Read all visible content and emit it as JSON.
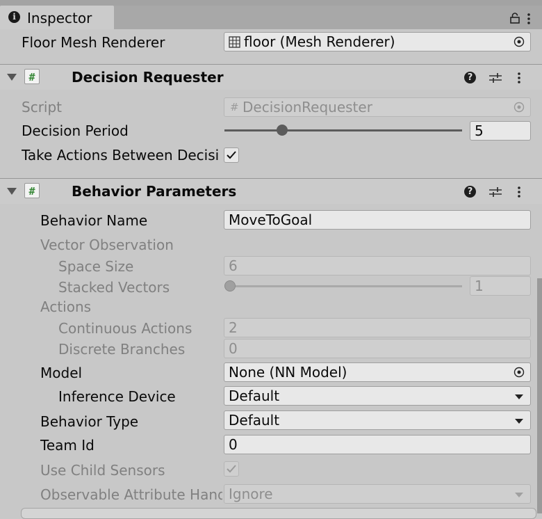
{
  "window": {
    "tab_title": "Inspector",
    "info_icon": "info-icon",
    "lock_icon": "lock-icon",
    "menu_icon": "kebab-menu-icon"
  },
  "floor_mesh": {
    "label": "Floor Mesh Renderer",
    "value": "floor (Mesh Renderer)",
    "icon": "mesh-renderer-icon"
  },
  "decision_requester": {
    "title": "Decision Requester",
    "script_label": "Script",
    "script_value": "DecisionRequester",
    "period_label": "Decision Period",
    "period_value": "5",
    "period_slider_fraction": 0.22,
    "take_actions_label": "Take Actions Between Decisi",
    "take_actions_checked": true
  },
  "behavior_parameters": {
    "title": "Behavior Parameters",
    "behavior_name_label": "Behavior Name",
    "behavior_name_value": "MoveToGoal",
    "vector_obs_label": "Vector Observation",
    "space_size_label": "Space Size",
    "space_size_value": "6",
    "stacked_vectors_label": "Stacked Vectors",
    "stacked_vectors_value": "1",
    "stacked_slider_fraction": 0.0,
    "actions_label": "Actions",
    "continuous_label": "Continuous Actions",
    "continuous_value": "2",
    "discrete_label": "Discrete Branches",
    "discrete_value": "0",
    "model_label": "Model",
    "model_value": "None (NN Model)",
    "inference_label": "Inference Device",
    "inference_value": "Default",
    "behavior_type_label": "Behavior Type",
    "behavior_type_value": "Default",
    "team_id_label": "Team Id",
    "team_id_value": "0",
    "child_sensors_label": "Use Child Sensors",
    "child_sensors_checked": true,
    "observable_label": "Observable Attribute Hand",
    "observable_value": "Ignore"
  },
  "colors": {
    "panel_bg": "#c8c8c8",
    "field_bg": "#e8e8e8",
    "disabled_text": "#808080"
  }
}
